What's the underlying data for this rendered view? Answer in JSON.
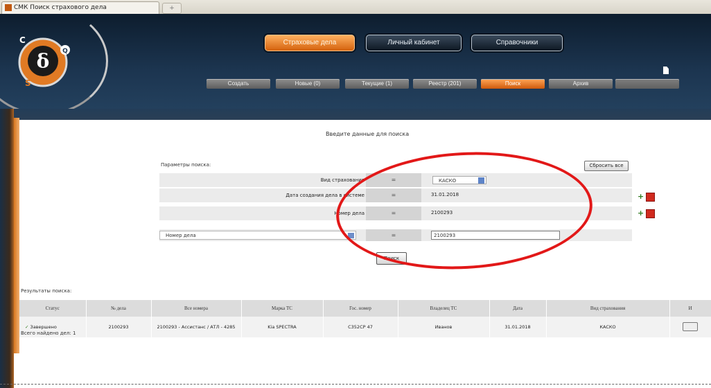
{
  "browser": {
    "tab_title": "СМК Поиск страхового дела",
    "new_tab": "+"
  },
  "header": {
    "logo_letters": [
      "С",
      "δ",
      "S",
      "Q"
    ],
    "main_tabs": [
      {
        "label": "Страховые дела",
        "active": true
      },
      {
        "label": "Личный кабинет",
        "active": false
      },
      {
        "label": "Справочники",
        "active": false
      }
    ],
    "sub_tabs": [
      {
        "label": "Создать",
        "state": "normal"
      },
      {
        "label": "Новые (0)",
        "state": "normal"
      },
      {
        "label": "Текущие (1)",
        "state": "normal"
      },
      {
        "label": "Реестр (201)",
        "state": "normal"
      },
      {
        "label": "Поиск",
        "state": "active"
      },
      {
        "label": "Архив",
        "state": "normal"
      },
      {
        "label": "",
        "state": "disabled"
      }
    ]
  },
  "search": {
    "heading": "Введите данные для поиска",
    "params_label": "Параметры поиска:",
    "reset_label": "Сбросить все",
    "rows": [
      {
        "label": "Вид страхования",
        "operator": "=",
        "value": "КАСКО",
        "type": "select"
      },
      {
        "label": "Дата создания дела в системе",
        "operator": "=",
        "value": "31.01.2018",
        "type": "text"
      },
      {
        "label": "Номер дела",
        "operator": "=",
        "value": "2100293",
        "type": "text"
      }
    ],
    "new_row": {
      "field": "Номер дела",
      "operator": "=",
      "value": "2100293"
    },
    "search_button": "Поиск"
  },
  "results": {
    "label": "Результаты поиска:",
    "columns": [
      "Статус",
      "№ дела",
      "Все номера",
      "Марка ТС",
      "Гос. номер",
      "Владелец ТС",
      "Дата",
      "Вид страхования",
      "И"
    ],
    "rows": [
      {
        "status": "Завершено",
        "case_no": "2100293",
        "all_numbers": "2100293 - Ассистанс / АТЛ - 4285",
        "brand": "Kia SPECTRA",
        "plate": "С352СР 47",
        "owner": "Иванов",
        "date": "31.01.2018",
        "insurance": "КАСКО"
      }
    ],
    "found_count": "Всего найдено дел: 1"
  },
  "colors": {
    "accent_orange": "#e07a24",
    "header_navy": "#1c3550",
    "highlight_red": "#e21818"
  }
}
